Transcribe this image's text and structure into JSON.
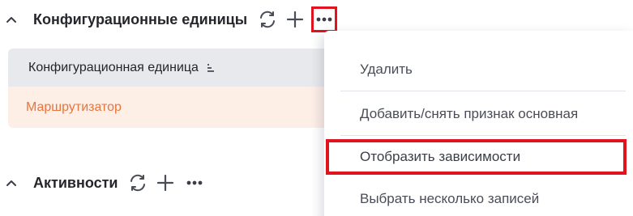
{
  "config_section": {
    "title": "Конфигурационные единицы",
    "table": {
      "column_header": "Конфигурационная единица",
      "rows": [
        "Маршрутизатор"
      ]
    }
  },
  "activity_section": {
    "title": "Активности"
  },
  "context_menu": {
    "items": [
      "Удалить",
      "Добавить/снять признак основная",
      "Отобразить зависимости",
      "Выбрать несколько записей"
    ]
  },
  "colors": {
    "accent_orange": "#e8753c",
    "highlight_red": "#e0141e",
    "row_selected_bg": "#fdeee6",
    "table_header_bg": "#e8e9ed"
  },
  "icons": [
    "chevron-up-icon",
    "refresh-icon",
    "plus-icon",
    "more-horizontal-icon",
    "sort-icon"
  ]
}
